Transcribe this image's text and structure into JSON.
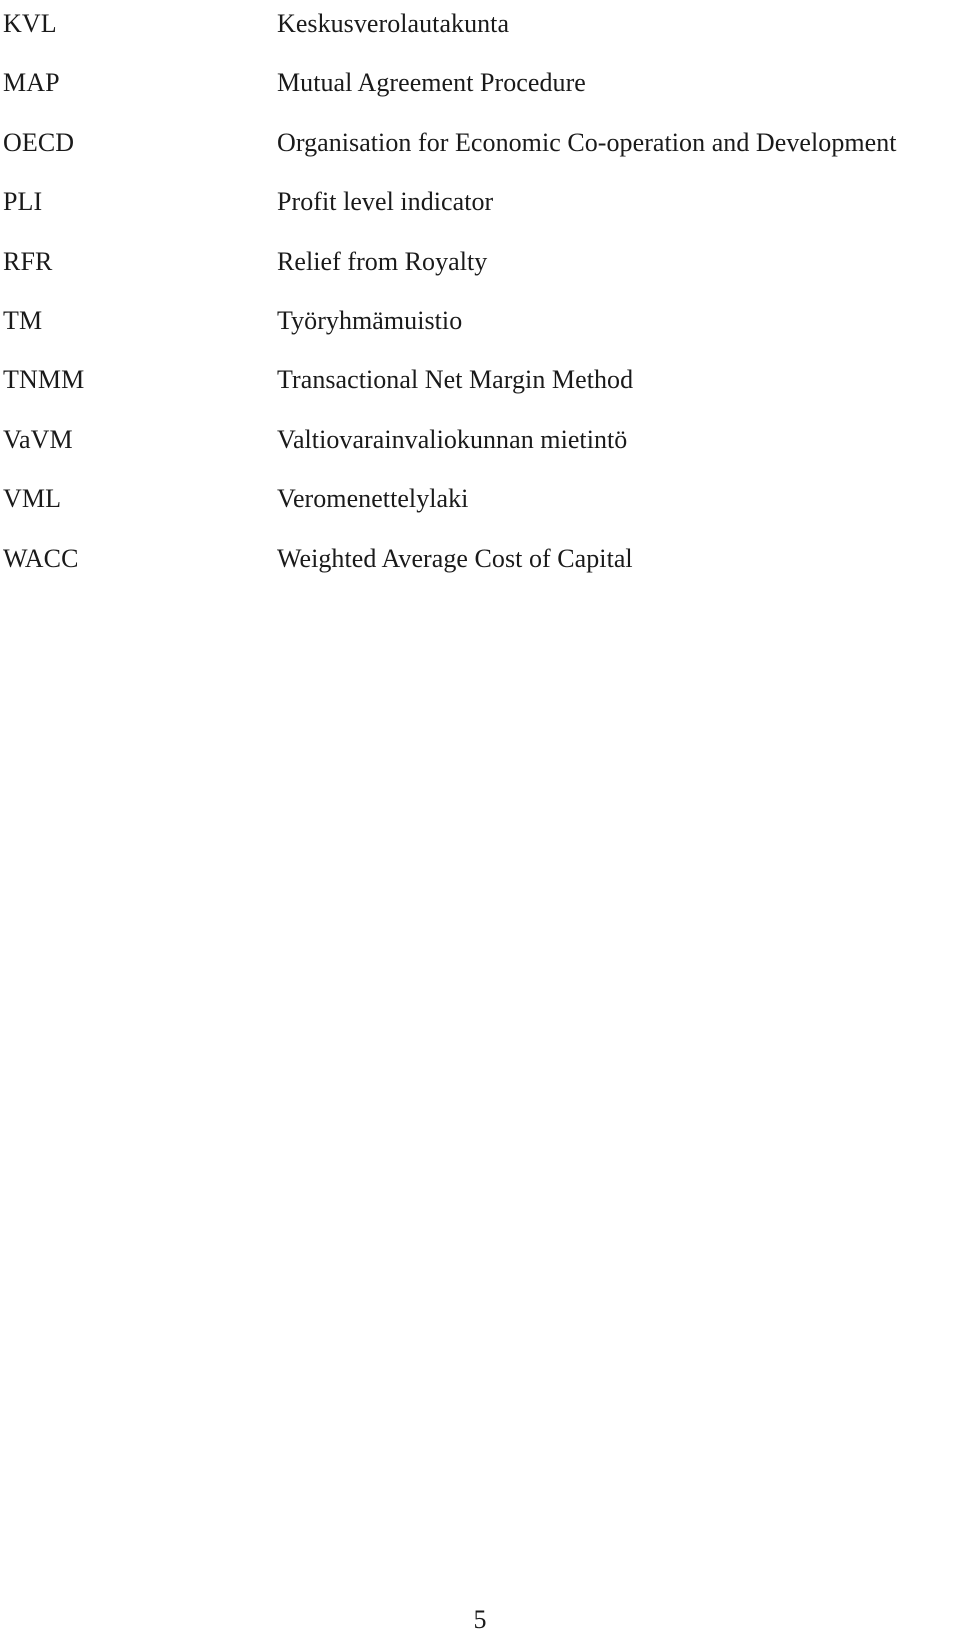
{
  "document": {
    "type": "abbreviations-list",
    "page_number": "5",
    "background_color": "#ffffff",
    "text_color": "#1a1a1a"
  },
  "abbreviations": [
    {
      "term": "KVL",
      "definition": "Keskusverolautakunta"
    },
    {
      "term": "MAP",
      "definition": "Mutual Agreement Procedure"
    },
    {
      "term": "OECD",
      "definition": "Organisation for Economic Co-operation and Development"
    },
    {
      "term": "PLI",
      "definition": "Profit level indicator"
    },
    {
      "term": "RFR",
      "definition": "Relief from Royalty"
    },
    {
      "term": "TM",
      "definition": "Työryhmämuistio"
    },
    {
      "term": "TNMM",
      "definition": "Transactional Net Margin Method"
    },
    {
      "term": "VaVM",
      "definition": "Valtiovarainvaliokunnan mietintö"
    },
    {
      "term": "VML",
      "definition": "Veromenettelylaki"
    },
    {
      "term": "WACC",
      "definition": "Weighted Average Cost of Capital"
    }
  ]
}
